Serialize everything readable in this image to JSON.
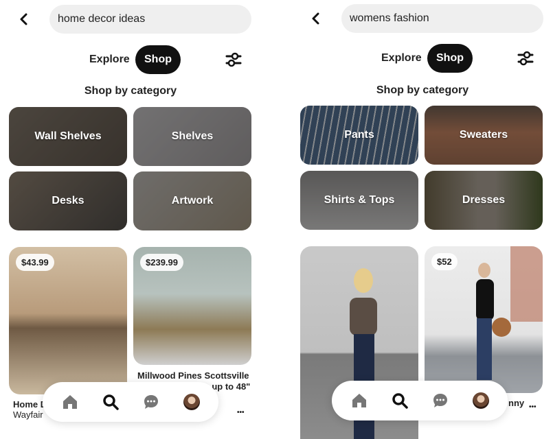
{
  "panels": [
    {
      "search": {
        "value": "home decor ideas"
      },
      "tabs": {
        "explore": "Explore",
        "shop": "Shop",
        "active": "Shop"
      },
      "section_title": "Shop by category",
      "categories": [
        {
          "label": "Wall Shelves",
          "bg": "#6b6259"
        },
        {
          "label": "Shelves",
          "bg": "#a9a7a8"
        },
        {
          "label": "Desks",
          "bg": "#6a6258"
        },
        {
          "label": "Artwork",
          "bg": "#a19e9a"
        }
      ],
      "pins": [
        {
          "price": "$43.99",
          "title": "Home D",
          "subtitle": "Wayfair",
          "bg": "#c8b49a"
        },
        {
          "price": "$239.99",
          "title": "Millwood Pines Scottsville",
          "title_line2": "TV Stand for TVs up to 48\"",
          "bg": "#b6c0bb"
        }
      ],
      "nav": [
        "home-icon",
        "search-icon",
        "messages-icon",
        "profile-avatar"
      ]
    },
    {
      "search": {
        "value": "womens fashion"
      },
      "tabs": {
        "explore": "Explore",
        "shop": "Shop",
        "active": "Shop"
      },
      "section_title": "Shop by category",
      "categories": [
        {
          "label": "Pants",
          "bg": "#4d5868"
        },
        {
          "label": "Sweaters",
          "bg": "#6b4a3c"
        },
        {
          "label": "Shirts & Tops",
          "bg": "#8e8c8b"
        },
        {
          "label": "Dresses",
          "bg": "#5d5443"
        }
      ],
      "pins": [
        {
          "price": "",
          "title": "",
          "bg": "#bdbdbd"
        },
        {
          "price": "$52",
          "title": "nny",
          "bg": "#d7d7d7"
        }
      ],
      "nav": [
        "home-icon",
        "search-icon",
        "messages-icon",
        "profile-avatar"
      ]
    }
  ],
  "more_label": "•••"
}
